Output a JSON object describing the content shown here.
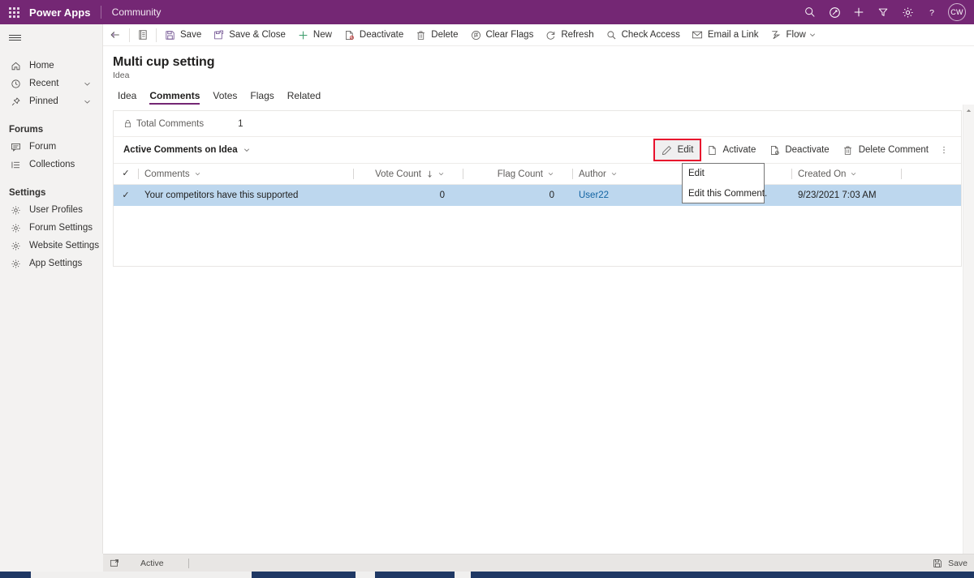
{
  "topbar": {
    "waffle_label": "waffle",
    "brand": "Power Apps",
    "app_name": "Community",
    "icons": [
      "search-icon",
      "assistant-icon",
      "plus-icon",
      "filter-icon",
      "gear-icon",
      "help-icon"
    ],
    "avatar_initials": "CW",
    "background_color": "#742774"
  },
  "sidebar": {
    "items": [
      {
        "label": "Home",
        "icon": "home-icon",
        "expandable": false
      },
      {
        "label": "Recent",
        "icon": "clock-icon",
        "expandable": true
      },
      {
        "label": "Pinned",
        "icon": "pin-icon",
        "expandable": true
      }
    ],
    "groups": [
      {
        "title": "Forums",
        "items": [
          {
            "label": "Forum",
            "icon": "forum-icon"
          },
          {
            "label": "Collections",
            "icon": "collections-icon"
          }
        ]
      },
      {
        "title": "Settings",
        "items": [
          {
            "label": "User Profiles",
            "icon": "gear-icon"
          },
          {
            "label": "Forum Settings",
            "icon": "gear-icon"
          },
          {
            "label": "Website Settings",
            "icon": "gear-icon"
          },
          {
            "label": "App Settings",
            "icon": "gear-icon"
          }
        ]
      }
    ]
  },
  "commandbar": {
    "back_label": "back-arrow",
    "form_selector_label": "form-selector",
    "buttons": [
      {
        "label": "Save",
        "icon": "save-icon"
      },
      {
        "label": "Save & Close",
        "icon": "save-close-icon"
      },
      {
        "label": "New",
        "icon": "plus-icon"
      },
      {
        "label": "Deactivate",
        "icon": "deactivate-icon"
      },
      {
        "label": "Delete",
        "icon": "trash-icon"
      },
      {
        "label": "Clear Flags",
        "icon": "clear-flags-icon"
      },
      {
        "label": "Refresh",
        "icon": "refresh-icon"
      },
      {
        "label": "Check Access",
        "icon": "check-access-icon"
      },
      {
        "label": "Email a Link",
        "icon": "email-icon"
      },
      {
        "label": "Flow",
        "icon": "flow-icon",
        "has_chevron": true
      }
    ]
  },
  "page": {
    "title": "Multi cup setting",
    "subtitle": "Idea",
    "tabs": [
      {
        "label": "Idea",
        "active": false
      },
      {
        "label": "Comments",
        "active": true
      },
      {
        "label": "Votes",
        "active": false
      },
      {
        "label": "Flags",
        "active": false
      },
      {
        "label": "Related",
        "active": false
      }
    ]
  },
  "form": {
    "total_comments_label": "Total Comments",
    "total_comments_value": "1",
    "lock_icon": "lock-icon"
  },
  "subgrid": {
    "view_name": "Active Comments on Idea",
    "commands": [
      {
        "label": "Edit",
        "icon": "edit-pencil-icon",
        "highlighted": true,
        "hovered": true
      },
      {
        "label": "Activate",
        "icon": "activate-icon",
        "highlighted": false,
        "hovered": false
      },
      {
        "label": "Deactivate",
        "icon": "deactivate-icon",
        "highlighted": false,
        "hovered": false
      },
      {
        "label": "Delete Comment",
        "icon": "trash-icon",
        "highlighted": false,
        "hovered": false
      }
    ],
    "overflow_label": "more-commands",
    "columns": [
      {
        "label": "Comments",
        "sorted": false
      },
      {
        "label": "Vote Count",
        "sorted": true,
        "sort_dir": "desc"
      },
      {
        "label": "Flag Count",
        "sorted": false
      },
      {
        "label": "Author",
        "sorted": false
      },
      {
        "label": "Created On",
        "sorted": false
      }
    ],
    "rows": [
      {
        "selected": true,
        "comment": "Your competitors have this supported",
        "vote_count": "0",
        "flag_count": "0",
        "author": "User22",
        "created_on": "9/23/2021 7:03 AM"
      }
    ],
    "selected_row_color": "#bdd7ee",
    "highlight_color": "#e8112d"
  },
  "tooltip": {
    "title": "Edit",
    "body": "Edit this Comment."
  },
  "statusbar": {
    "state_label": "Active",
    "save_label": "Save",
    "save_icon": "save-icon",
    "left_icon": "popout-icon"
  }
}
